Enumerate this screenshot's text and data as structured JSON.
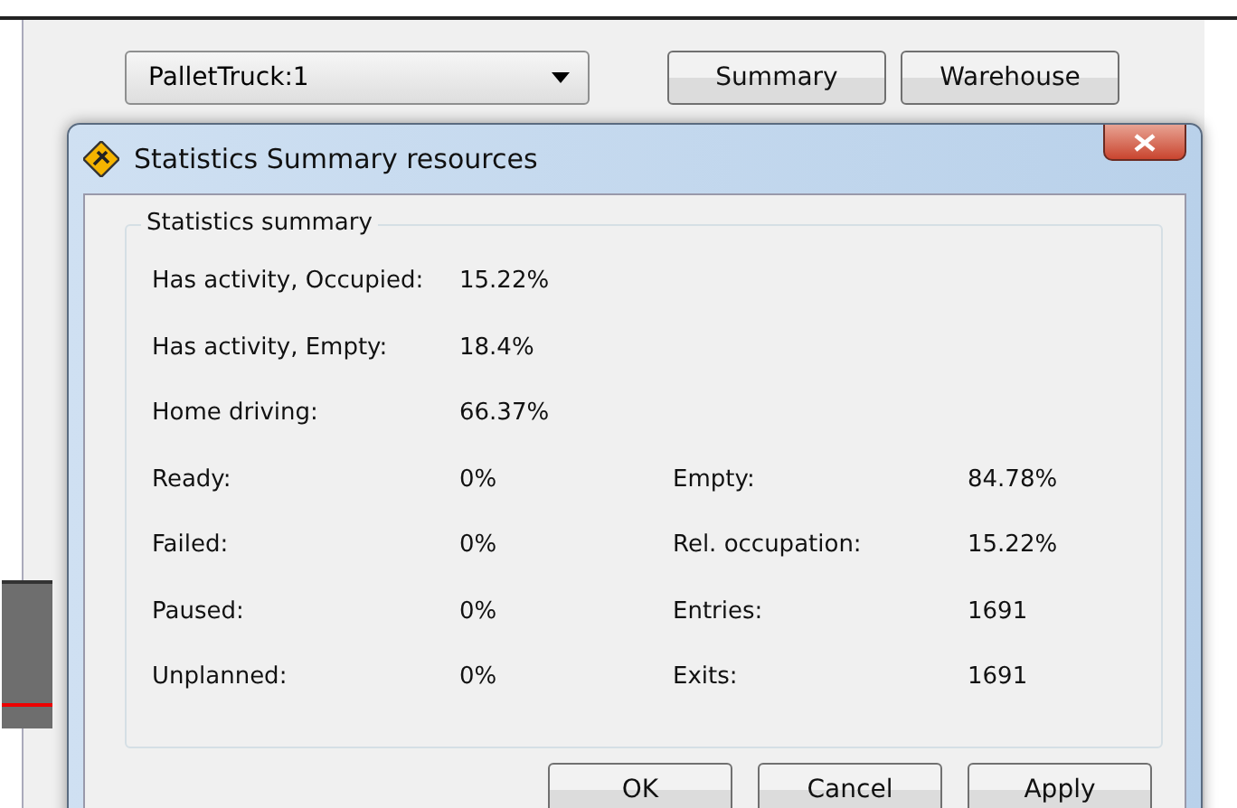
{
  "background_window": {
    "resource_dropdown": {
      "value": "PalletTruck:1"
    },
    "buttons": [
      "Summary",
      "Warehouse"
    ]
  },
  "dialog": {
    "title": "Statistics Summary resources",
    "group_title": "Statistics summary",
    "rows": [
      {
        "label": "Has activity, Occupied:",
        "value": "15.22%"
      },
      {
        "label": "Has activity, Empty:",
        "value": "18.4%"
      },
      {
        "label": "Home driving:",
        "value": "66.37%"
      },
      {
        "label": "Ready:",
        "value": "0%",
        "label_2": "Empty:",
        "value_2": "84.78%"
      },
      {
        "label": "Failed:",
        "value": "0%",
        "label_2": "Rel. occupation:",
        "value_2": "15.22%"
      },
      {
        "label": "Paused:",
        "value": "0%",
        "label_2": "Entries:",
        "value_2": "1691"
      },
      {
        "label": "Unplanned:",
        "value": "0%",
        "label_2": "Exits:",
        "value_2": "1691"
      }
    ],
    "buttons": [
      "OK",
      "Cancel",
      "Apply"
    ]
  }
}
